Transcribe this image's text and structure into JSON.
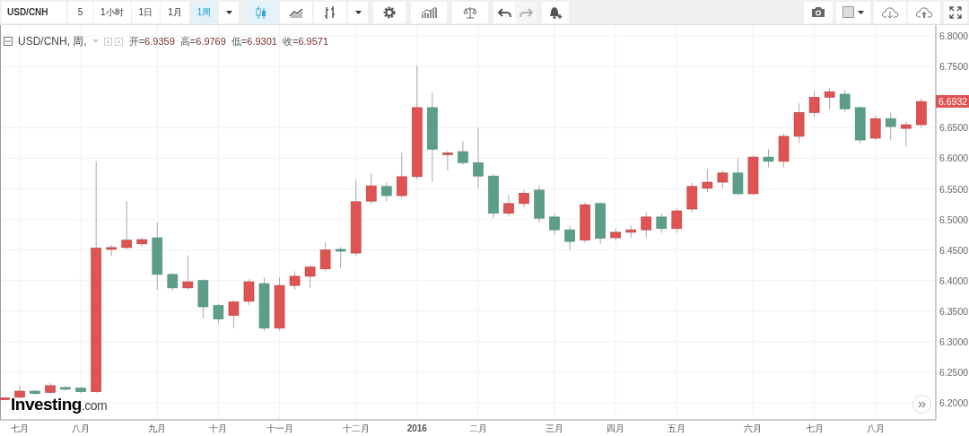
{
  "toolbar": {
    "symbol": "USD/CNH",
    "intervals": [
      {
        "label": "5",
        "selected": false
      },
      {
        "label": "1小时",
        "selected": false
      },
      {
        "label": "1日",
        "selected": false
      },
      {
        "label": "1月",
        "selected": false
      },
      {
        "label": "1周",
        "selected": true
      }
    ],
    "chart_styles": [
      {
        "kind": "candles",
        "selected": true
      },
      {
        "kind": "area",
        "selected": false
      },
      {
        "kind": "bars",
        "selected": false
      }
    ],
    "undo": {
      "disabled": false
    },
    "redo": {
      "disabled": true
    }
  },
  "legend": {
    "title": "USD/CNH, 周,",
    "values": [
      {
        "label": "开=",
        "value": "6.9359"
      },
      {
        "label": "高=",
        "value": "6.9769"
      },
      {
        "label": "低=",
        "value": "6.9301"
      },
      {
        "label": "收=",
        "value": "6.9571"
      }
    ]
  },
  "chart": {
    "logo": {
      "brand": "Investing",
      "suffix": ".com"
    },
    "last_price": "6.6932",
    "chart_data": {
      "type": "candlestick",
      "grid": true,
      "ylim": [
        6.172,
        6.818
      ],
      "yticks": [
        {
          "value": 6.2,
          "label": "6.2000"
        },
        {
          "value": 6.25,
          "label": "6.2500"
        },
        {
          "value": 6.3,
          "label": "6.3000"
        },
        {
          "value": 6.35,
          "label": "6.3500"
        },
        {
          "value": 6.4,
          "label": "6.4000"
        },
        {
          "value": 6.45,
          "label": "6.4500"
        },
        {
          "value": 6.5,
          "label": "6.5000"
        },
        {
          "value": 6.55,
          "label": "6.5500"
        },
        {
          "value": 6.6,
          "label": "6.6000"
        },
        {
          "value": 6.65,
          "label": "6.6500"
        },
        {
          "value": 6.75,
          "label": "6.7500"
        },
        {
          "value": 6.8,
          "label": "6.8000"
        }
      ],
      "categories": [
        null,
        "七月",
        null,
        null,
        null,
        "八月",
        null,
        null,
        null,
        null,
        "九月",
        null,
        null,
        null,
        "十月",
        null,
        null,
        null,
        "十一月",
        null,
        null,
        null,
        null,
        "十二月",
        null,
        null,
        null,
        "2016",
        null,
        null,
        null,
        "二月",
        null,
        null,
        null,
        null,
        "三月",
        null,
        null,
        null,
        "四月",
        null,
        null,
        null,
        "五月",
        null,
        null,
        null,
        null,
        "六月",
        null,
        null,
        null,
        "七月",
        null,
        null,
        null,
        "八月",
        null,
        null,
        null
      ],
      "ohlc": [
        [
          6.205,
          6.209,
          6.204,
          6.208
        ],
        [
          6.209,
          6.228,
          6.207,
          6.219
        ],
        [
          6.219,
          6.221,
          6.213,
          6.215
        ],
        [
          6.217,
          6.232,
          6.215,
          6.228
        ],
        [
          6.225,
          6.227,
          6.22,
          6.222
        ],
        [
          6.224,
          6.226,
          6.216,
          6.218
        ],
        [
          6.218,
          6.595,
          6.216,
          6.453
        ],
        [
          6.451,
          6.458,
          6.44,
          6.454
        ],
        [
          6.454,
          6.53,
          6.451,
          6.466
        ],
        [
          6.46,
          6.47,
          6.455,
          6.467
        ],
        [
          6.47,
          6.495,
          6.385,
          6.41
        ],
        [
          6.41,
          6.412,
          6.384,
          6.388
        ],
        [
          6.388,
          6.441,
          6.385,
          6.398
        ],
        [
          6.4,
          6.402,
          6.338,
          6.357
        ],
        [
          6.359,
          6.362,
          6.33,
          6.337
        ],
        [
          6.343,
          6.368,
          6.322,
          6.365
        ],
        [
          6.366,
          6.402,
          6.36,
          6.398
        ],
        [
          6.395,
          6.405,
          6.318,
          6.322
        ],
        [
          6.322,
          6.405,
          6.318,
          6.392
        ],
        [
          6.392,
          6.415,
          6.385,
          6.407
        ],
        [
          6.407,
          6.425,
          6.388,
          6.422
        ],
        [
          6.419,
          6.463,
          6.415,
          6.45
        ],
        [
          6.451,
          6.455,
          6.42,
          6.448
        ],
        [
          6.445,
          6.565,
          6.44,
          6.529
        ],
        [
          6.53,
          6.576,
          6.525,
          6.555
        ],
        [
          6.554,
          6.56,
          6.53,
          6.539
        ],
        [
          6.539,
          6.609,
          6.535,
          6.57
        ],
        [
          6.57,
          6.752,
          6.565,
          6.683
        ],
        [
          6.683,
          6.708,
          6.561,
          6.615
        ],
        [
          6.606,
          6.612,
          6.58,
          6.609
        ],
        [
          6.611,
          6.628,
          6.59,
          6.593
        ],
        [
          6.593,
          6.65,
          6.551,
          6.571
        ],
        [
          6.571,
          6.575,
          6.502,
          6.51
        ],
        [
          6.51,
          6.54,
          6.505,
          6.526
        ],
        [
          6.526,
          6.548,
          6.52,
          6.543
        ],
        [
          6.548,
          6.556,
          6.495,
          6.502
        ],
        [
          6.504,
          6.51,
          6.475,
          6.483
        ],
        [
          6.483,
          6.49,
          6.45,
          6.464
        ],
        [
          6.466,
          6.528,
          6.462,
          6.524
        ],
        [
          6.526,
          6.528,
          6.46,
          6.469
        ],
        [
          6.47,
          6.485,
          6.465,
          6.479
        ],
        [
          6.479,
          6.49,
          6.47,
          6.483
        ],
        [
          6.483,
          6.512,
          6.47,
          6.504
        ],
        [
          6.504,
          6.51,
          6.478,
          6.485
        ],
        [
          6.485,
          6.518,
          6.478,
          6.514
        ],
        [
          6.517,
          6.56,
          6.512,
          6.554
        ],
        [
          6.551,
          6.582,
          6.545,
          6.561
        ],
        [
          6.561,
          6.58,
          6.55,
          6.576
        ],
        [
          6.576,
          6.6,
          6.54,
          6.542
        ],
        [
          6.542,
          6.605,
          6.54,
          6.602
        ],
        [
          6.602,
          6.615,
          6.585,
          6.595
        ],
        [
          6.595,
          6.64,
          6.585,
          6.636
        ],
        [
          6.636,
          6.69,
          6.625,
          6.675
        ],
        [
          6.675,
          6.71,
          6.668,
          6.7
        ],
        [
          6.7,
          6.715,
          6.68,
          6.709
        ],
        [
          6.705,
          6.712,
          6.675,
          6.681
        ],
        [
          6.683,
          6.685,
          6.625,
          6.63
        ],
        [
          6.633,
          6.67,
          6.63,
          6.665
        ],
        [
          6.665,
          6.675,
          6.63,
          6.652
        ],
        [
          6.649,
          6.66,
          6.62,
          6.655
        ],
        [
          6.655,
          6.698,
          6.65,
          6.693
        ]
      ]
    }
  }
}
